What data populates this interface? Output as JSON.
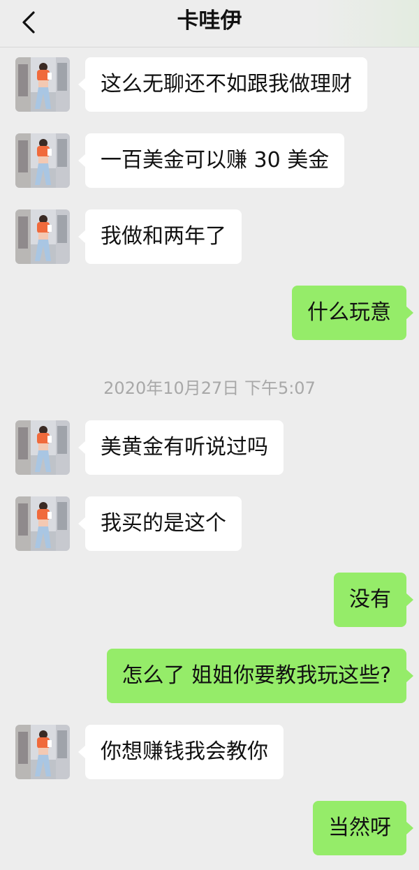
{
  "header": {
    "title": "卡哇伊",
    "back_icon": "chevron-left-icon"
  },
  "colors": {
    "background": "#ededed",
    "incoming_bubble": "#ffffff",
    "outgoing_bubble": "#95ec69",
    "timestamp_text": "#a8a8a8"
  },
  "messages": [
    {
      "side": "in",
      "text": "这么无聊还不如跟我做理财"
    },
    {
      "side": "in",
      "text": "一百美金可以赚 30 美金"
    },
    {
      "side": "in",
      "text": "我做和两年了"
    },
    {
      "side": "out",
      "text": "什么玩意"
    },
    {
      "side": "in",
      "text": "美黄金有听说过吗"
    },
    {
      "side": "in",
      "text": "我买的是这个"
    },
    {
      "side": "out",
      "text": "没有"
    },
    {
      "side": "out",
      "text": "怎么了 姐姐你要教我玩这些?"
    },
    {
      "side": "in",
      "text": "你想赚钱我会教你"
    },
    {
      "side": "out",
      "text": "当然呀"
    }
  ],
  "timestamp": "2020年10月27日 下午5:07"
}
